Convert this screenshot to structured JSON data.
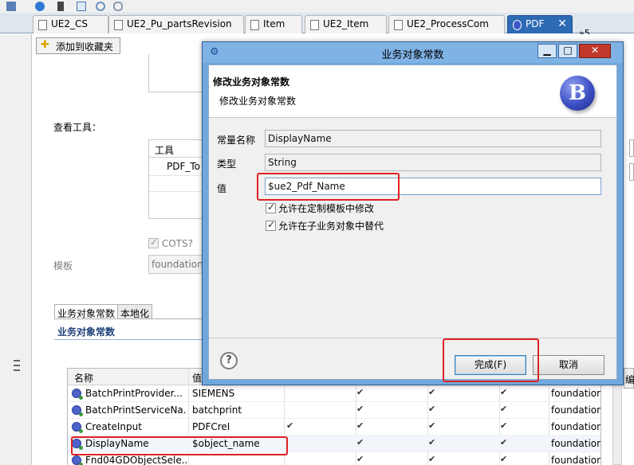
{
  "tabs": [
    {
      "label": "UE2_CS",
      "active": false
    },
    {
      "label": "UE2_Pu_partsRevision",
      "active": false
    },
    {
      "label": "Item",
      "active": false
    },
    {
      "label": "UE2_Item",
      "active": false
    },
    {
      "label": "UE2_ProcessCom",
      "active": false
    },
    {
      "label": "PDF",
      "active": true
    }
  ],
  "tab_overflow": "»5",
  "toolbar": {
    "add_favorites_label": "添加到收藏夹"
  },
  "editor": {
    "view_tools_label": "查看工具：",
    "tools_column_header": "工具",
    "tools_value": "PDF_To",
    "cots_label": "COTS?",
    "template_label": "模板",
    "template_value": "foundation"
  },
  "subtabs": [
    {
      "label": "业务对象常数",
      "active": true
    },
    {
      "label": "本地化",
      "active": false
    }
  ],
  "section_title": "业务对象常数",
  "table": {
    "headers": [
      "名称",
      "值"
    ],
    "rows": [
      {
        "name": "BatchPrintProvider...",
        "value": "SIEMENS",
        "checks": [
          false,
          true,
          true,
          true,
          true
        ],
        "template": "foundation"
      },
      {
        "name": "BatchPrintServiceNa...",
        "value": "batchprint",
        "checks": [
          false,
          true,
          true,
          true,
          true
        ],
        "template": "foundation"
      },
      {
        "name": "CreateInput",
        "value": "PDFCreI",
        "checks": [
          true,
          true,
          true,
          true,
          true
        ],
        "template": "foundation"
      },
      {
        "name": "DisplayName",
        "value": "$object_name",
        "checks": [
          false,
          true,
          true,
          true,
          true
        ],
        "template": "foundation"
      },
      {
        "name": "Fnd04GDObjectSele...",
        "value": "",
        "checks": [
          false,
          true,
          true,
          true,
          true
        ],
        "template": "foundation"
      }
    ]
  },
  "right_stubs": {
    "button_label": "编"
  },
  "dialog": {
    "title": "业务对象常数",
    "header_title": "修改业务对象常数",
    "header_subtitle": "修改业务对象常数",
    "logo_letter": "B",
    "fields": {
      "name_label": "常量名称",
      "name_value": "DisplayName",
      "type_label": "类型",
      "type_value": "String",
      "value_label": "值",
      "value_value": "$ue2_Pdf_Name"
    },
    "checkboxes": [
      {
        "label": "允许在定制模板中修改",
        "checked": true
      },
      {
        "label": "允许在子业务对象中替代",
        "checked": true
      }
    ],
    "finish_label": "完成(F)",
    "cancel_label": "取消",
    "help_symbol": "?"
  },
  "colors": {
    "dialog_frame": "#6fa8dc",
    "annotation": "#e02020",
    "active_tab": "#2d6bb4"
  },
  "icons": [
    "help-icon",
    "star-icon",
    "b-logo-icon",
    "file-icon",
    "close-icon",
    "maximize-icon",
    "minimize-icon"
  ]
}
